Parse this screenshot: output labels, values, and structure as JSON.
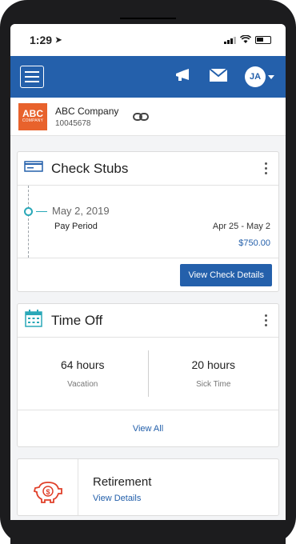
{
  "status_bar": {
    "time": "1:29"
  },
  "nav": {
    "avatar_initials": "JA"
  },
  "company": {
    "logo_big": "ABC",
    "logo_small": "COMPANY",
    "name": "ABC Company",
    "id": "10045678"
  },
  "check_stubs": {
    "title": "Check Stubs",
    "date": "May 2, 2019",
    "period_label": "Pay Period",
    "period_range": "Apr 25 - May 2",
    "amount": "$750.00",
    "button_label": "View Check Details"
  },
  "time_off": {
    "title": "Time Off",
    "vacation_value": "64 hours",
    "vacation_label": "Vacation",
    "sick_value": "20 hours",
    "sick_label": "Sick Time",
    "link_label": "View All"
  },
  "retirement": {
    "title": "Retirement",
    "link_label": "View Details"
  },
  "colors": {
    "brand_blue": "#2460ab",
    "logo_orange": "#e8622c",
    "timeline_teal": "#2aa8b8",
    "piggy_red": "#e0402a"
  }
}
